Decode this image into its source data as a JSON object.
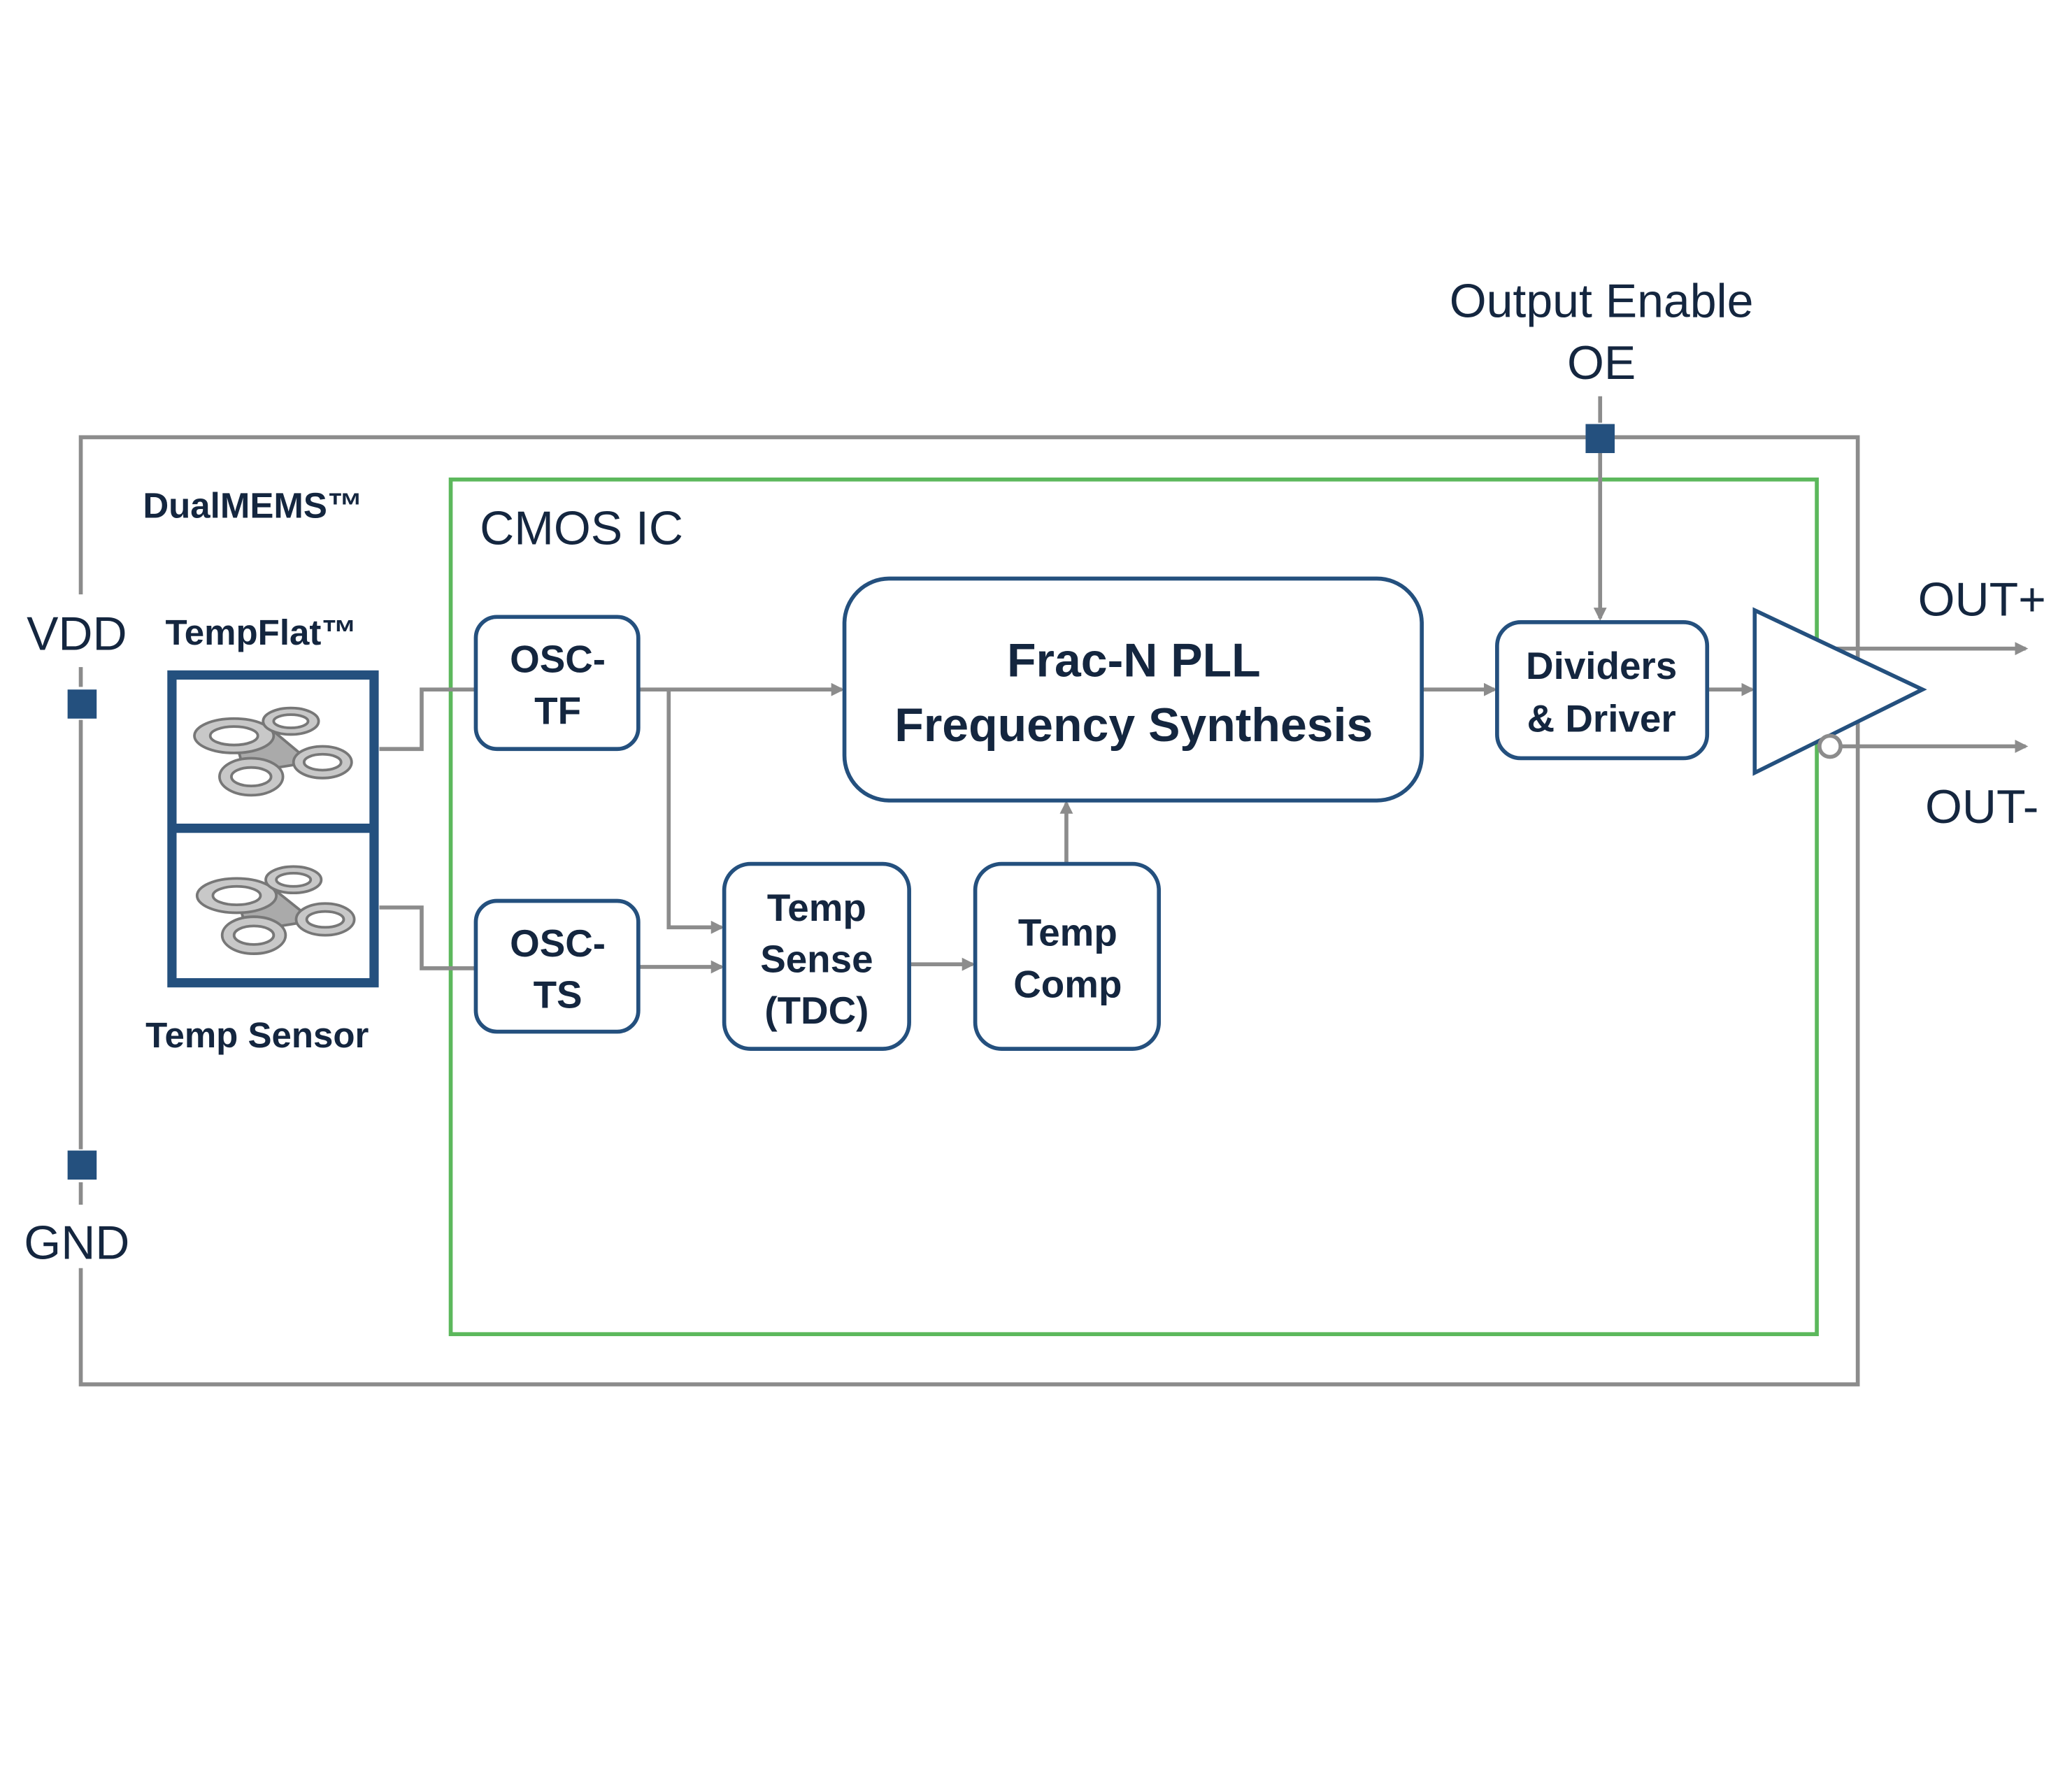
{
  "pins": {
    "vdd": "VDD",
    "gnd": "GND",
    "oe_line1": "Output Enable",
    "oe_line2": "OE",
    "out_pos": "OUT+",
    "out_neg": "OUT-"
  },
  "labels": {
    "dualmems": "DualMEMS™",
    "tempflat": "TempFlat™",
    "temp_sensor": "Temp Sensor",
    "cmos_ic": "CMOS IC"
  },
  "blocks": {
    "osc_tf": [
      "OSC-",
      "TF"
    ],
    "osc_ts": [
      "OSC-",
      "TS"
    ],
    "pll": [
      "Frac-N PLL",
      "Frequency Synthesis"
    ],
    "temp_sense": [
      "Temp",
      "Sense",
      "(TDC)"
    ],
    "temp_comp": [
      "Temp",
      "Comp"
    ],
    "dividers": [
      "Dividers",
      "& Driver"
    ]
  },
  "colors": {
    "block_border": "#24507e",
    "text": "#14263f",
    "wire": "#8c8c8c",
    "cmos_border": "#5cb85c",
    "pad": "#24507e"
  }
}
